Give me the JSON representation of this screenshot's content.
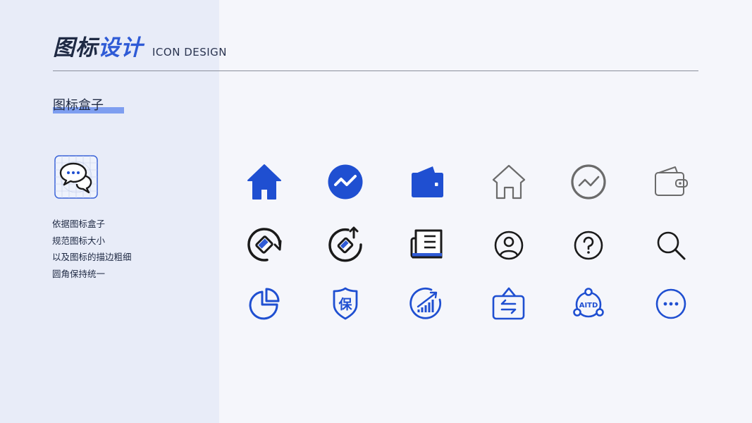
{
  "header": {
    "title_part1": "图标",
    "title_part2": "设计",
    "title_en": "ICON DESIGN"
  },
  "section": {
    "subtitle": "图标盒子",
    "description": [
      "依据图标盒子",
      "规范图标大小",
      "以及图标的描边粗细",
      "圆角保持统一"
    ]
  },
  "colors": {
    "accent_blue": "#1f4fd1",
    "dark": "#1a1a1a",
    "gray": "#6b6b6b",
    "left_panel": "#e8ecf8",
    "background": "#f5f6fb"
  },
  "icon_box": {
    "icon": "chat-bubbles-icon"
  },
  "icon_rows": [
    [
      "home-filled-icon",
      "trend-circle-filled-icon",
      "wallet-filled-icon",
      "home-outline-icon",
      "trend-circle-outline-icon",
      "wallet-outline-icon"
    ],
    [
      "cycle-eraser-icon",
      "refresh-upload-icon",
      "newspaper-icon",
      "user-circle-icon",
      "help-circle-icon",
      "search-icon"
    ],
    [
      "pie-chart-icon",
      "insurance-shield-icon",
      "growth-chart-icon",
      "exchange-sign-icon",
      "aitd-network-icon",
      "more-circle-icon"
    ]
  ],
  "icon_text": {
    "shield_char": "保",
    "network_label": "AITD"
  }
}
